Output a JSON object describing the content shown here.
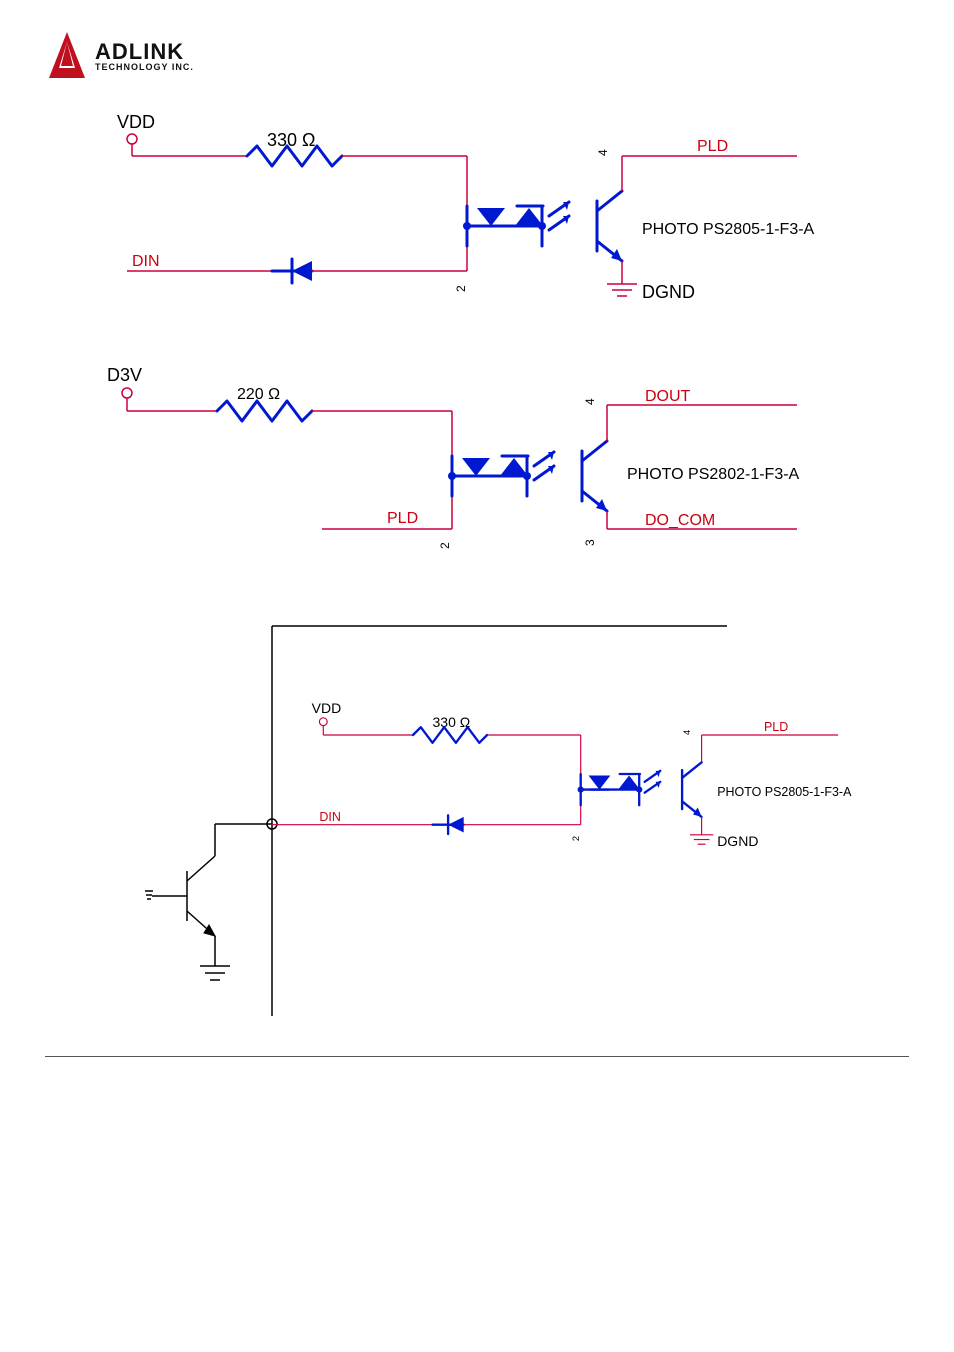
{
  "logo": {
    "title": "ADLINK",
    "subtitle": "TECHNOLOGY INC."
  },
  "circuits": [
    {
      "id": "din",
      "supply": "VDD",
      "resistor": "330 Ω",
      "input_label": "DIN",
      "out_top": "PLD",
      "out_bot": "DGND",
      "opto_label": "PHOTO PS2805-1-F3-A",
      "pin_a": "2",
      "pin_b": "4",
      "has_ground_on_output": true,
      "has_series_diode_on_input": true
    },
    {
      "id": "dout",
      "supply": "D3V",
      "resistor": "220 Ω",
      "input_label": "PLD",
      "out_top": "DOUT",
      "out_bot": "DO_COM",
      "opto_label": "PHOTO PS2802-1-F3-A",
      "pin_a": "2",
      "pin_b": "4",
      "pin_c": "3",
      "has_ground_on_output": false,
      "has_series_diode_on_input": false
    },
    {
      "id": "npn-din",
      "supply": "VDD",
      "resistor": "330 Ω",
      "input_label": "DIN",
      "out_top": "PLD",
      "out_bot": "DGND",
      "opto_label": "PHOTO PS2805-1-F3-A",
      "pin_a": "2",
      "pin_b": "4",
      "has_ground_on_output": true,
      "has_series_diode_on_input": true
    }
  ]
}
